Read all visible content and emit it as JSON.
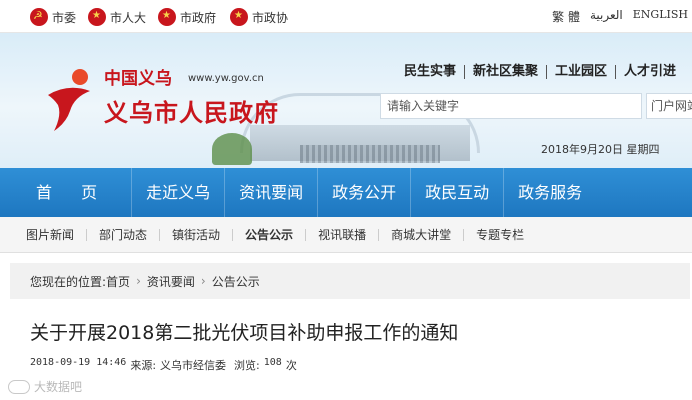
{
  "topbar": {
    "links": [
      {
        "label": "市委",
        "icon": "party-emblem-icon"
      },
      {
        "label": "市人大",
        "icon": "national-emblem-icon"
      },
      {
        "label": "市政府",
        "icon": "national-emblem-icon"
      },
      {
        "label": "市政协",
        "icon": "cppcc-emblem-icon"
      }
    ],
    "languages": [
      "繁 體",
      "العربية",
      "ENGLISH"
    ]
  },
  "header": {
    "logo_small": "中国义乌",
    "logo_url": "www.yw.gov.cn",
    "logo_title": "义乌市人民政府",
    "quick_links": [
      "民生实事",
      "新社区集聚",
      "工业园区",
      "人才引进"
    ],
    "search_placeholder": "请输入关键字",
    "search_scope": "门户网站",
    "date": "2018年9月20日  星期四"
  },
  "main_nav": [
    "首 页",
    "走近义乌",
    "资讯要闻",
    "政务公开",
    "政民互动",
    "政务服务"
  ],
  "sub_nav": {
    "items": [
      "图片新闻",
      "部门动态",
      "镇街活动",
      "公告公示",
      "视讯联播",
      "商城大讲堂",
      "专题专栏"
    ],
    "active": "公告公示"
  },
  "breadcrumb": {
    "prefix": "您现在的位置:",
    "items": [
      "首页",
      "资讯要闻",
      "公告公示"
    ]
  },
  "article": {
    "title": "关于开展2018第二批光伏项目补助申报工作的通知",
    "datetime": "2018-09-19 14:46",
    "source_label": "来源:",
    "source": "义乌市经信委",
    "views_label": "浏览:",
    "views": "108",
    "views_unit": "次"
  },
  "watermark": "大数据吧",
  "colors": {
    "nav_blue": "#1e77c0",
    "brand_red": "#c8161d"
  }
}
